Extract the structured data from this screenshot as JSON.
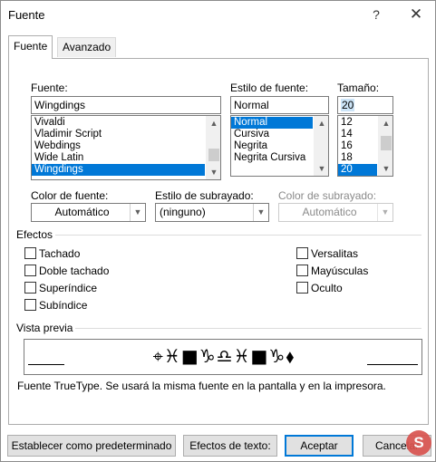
{
  "window": {
    "title": "Fuente",
    "help": "?",
    "close": "✕"
  },
  "tabs": [
    {
      "label": "Fuente",
      "active": true
    },
    {
      "label": "Avanzado",
      "active": false
    }
  ],
  "font": {
    "label": "Fuente:",
    "value": "Wingdings",
    "items": [
      "Vivaldi",
      "Vladimir Script",
      "Webdings",
      "Wide Latin",
      "Wingdings"
    ],
    "selected_index": 4
  },
  "style": {
    "label": "Estilo de fuente:",
    "value": "Normal",
    "items": [
      "Normal",
      "Cursiva",
      "Negrita",
      "Negrita Cursiva"
    ],
    "selected_index": 0
  },
  "size": {
    "label": "Tamaño:",
    "value": "20",
    "items": [
      "12",
      "14",
      "16",
      "18",
      "20"
    ],
    "selected_index": 4
  },
  "color": {
    "label": "Color de fuente:",
    "value": "Automático"
  },
  "underline": {
    "label": "Estilo de subrayado:",
    "value": "(ninguno)"
  },
  "underline_color": {
    "label": "Color de subrayado:",
    "value": "Automático",
    "disabled": true
  },
  "effects": {
    "label": "Efectos",
    "left": [
      {
        "label": "Tachado",
        "checked": false
      },
      {
        "label": "Doble tachado",
        "checked": false
      },
      {
        "label": "Superíndice",
        "checked": false
      },
      {
        "label": "Subíndice",
        "checked": false
      }
    ],
    "right": [
      {
        "label": "Versalitas",
        "checked": false
      },
      {
        "label": "Mayúsculas",
        "checked": false
      },
      {
        "label": "Oculto",
        "checked": false
      }
    ]
  },
  "preview": {
    "label": "Vista previa",
    "sample": "⌖♓■♑♎♓■♑⬧",
    "note": "Fuente TrueType. Se usará la misma fuente en la pantalla y en la impresora."
  },
  "buttons": {
    "set_default": "Establecer como predeterminado",
    "text_effects": "Efectos de texto:",
    "ok": "Aceptar",
    "cancel": "Cancelar"
  },
  "watermark": "S"
}
